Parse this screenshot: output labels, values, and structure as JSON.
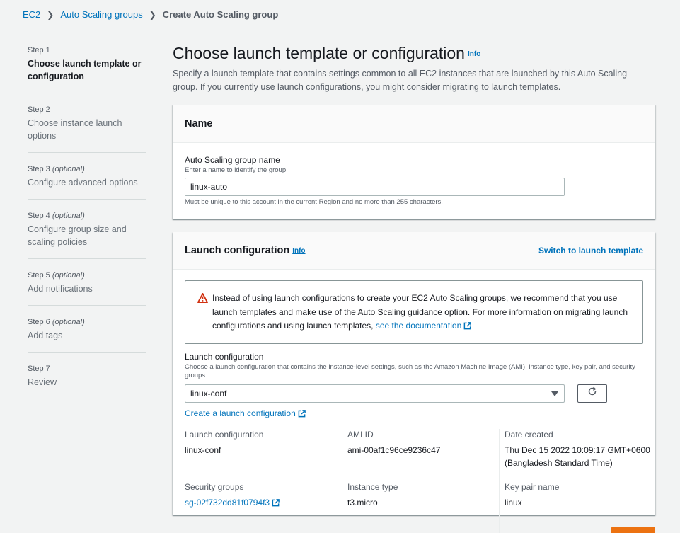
{
  "breadcrumb": {
    "root": "EC2",
    "parent": "Auto Scaling groups",
    "current": "Create Auto Scaling group"
  },
  "steps": [
    {
      "num": "Step 1",
      "optional": "",
      "title": "Choose launch template or configuration"
    },
    {
      "num": "Step 2",
      "optional": "",
      "title": "Choose instance launch options"
    },
    {
      "num": "Step 3",
      "optional": "(optional)",
      "title": "Configure advanced options"
    },
    {
      "num": "Step 4",
      "optional": "(optional)",
      "title": "Configure group size and scaling policies"
    },
    {
      "num": "Step 5",
      "optional": "(optional)",
      "title": "Add notifications"
    },
    {
      "num": "Step 6",
      "optional": "(optional)",
      "title": "Add tags"
    },
    {
      "num": "Step 7",
      "optional": "",
      "title": "Review"
    }
  ],
  "page": {
    "title": "Choose launch template or configuration",
    "info": "Info",
    "description": "Specify a launch template that contains settings common to all EC2 instances that are launched by this Auto Scaling group. If you currently use launch configurations, you might consider migrating to launch templates."
  },
  "name_panel": {
    "heading": "Name",
    "label": "Auto Scaling group name",
    "desc": "Enter a name to identify the group.",
    "value": "linux-auto",
    "hint": "Must be unique to this account in the current Region and no more than 255 characters."
  },
  "lc_panel": {
    "heading": "Launch configuration",
    "info": "Info",
    "switch_link": "Switch to launch template",
    "alert_text": "Instead of using launch configurations to create your EC2 Auto Scaling groups, we recommend that you use launch templates and make use of the Auto Scaling guidance option. For more information on migrating launch configurations and using launch templates,",
    "alert_link": "see the documentation",
    "select_label": "Launch configuration",
    "select_desc": "Choose a launch configuration that contains the instance-level settings, such as the Amazon Machine Image (AMI), instance type, key pair, and security groups.",
    "select_value": "linux-conf",
    "create_link": "Create a launch configuration",
    "details": {
      "lc_key": "Launch configuration",
      "lc_val": "linux-conf",
      "ami_key": "AMI ID",
      "ami_val": "ami-00af1c96ce9236c47",
      "date_key": "Date created",
      "date_val": "Thu Dec 15 2022 10:09:17 GMT+0600 (Bangladesh Standard Time)",
      "sg_key": "Security groups",
      "sg_val": "sg-02f732dd81f0794f3",
      "type_key": "Instance type",
      "type_val": "t3.micro",
      "key_key": "Key pair name",
      "key_val": "linux"
    }
  },
  "colors": {
    "link": "#0073bb",
    "primary_button": "#ec7211",
    "warning": "#d13212"
  },
  "icons": {
    "warning": "warning-icon",
    "external": "external-link-icon",
    "refresh": "refresh-icon",
    "caret": "caret-down-icon",
    "chevron": "chevron-right-icon"
  }
}
